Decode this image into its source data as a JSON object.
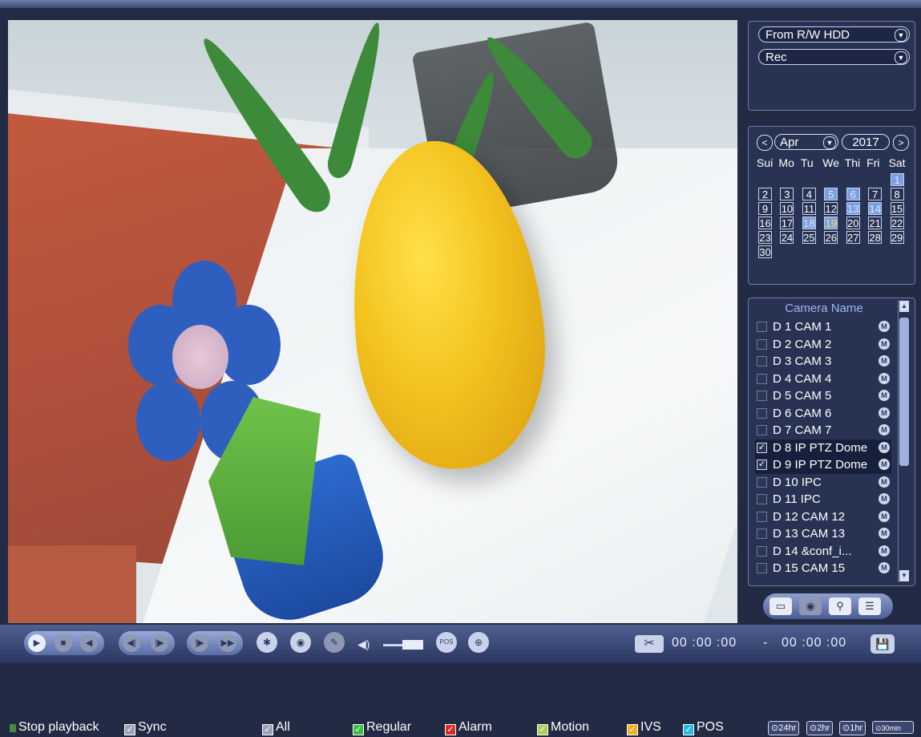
{
  "source": {
    "select_value": "From R/W HDD",
    "type_value": "Rec"
  },
  "calendar": {
    "prev_label": "<",
    "next_label": ">",
    "month": "Apr",
    "year": "2017",
    "weekdays": [
      "Sui",
      "Mo",
      "Tu",
      "We",
      "Thi",
      "Fri",
      "Sat"
    ],
    "days": [
      {
        "label": "",
        "state": "blank"
      },
      {
        "label": "",
        "state": "blank"
      },
      {
        "label": "",
        "state": "blank"
      },
      {
        "label": "",
        "state": "blank"
      },
      {
        "label": "",
        "state": "blank"
      },
      {
        "label": "",
        "state": "blank"
      },
      {
        "label": "1",
        "state": "rec"
      },
      {
        "label": "2",
        "state": ""
      },
      {
        "label": "3",
        "state": ""
      },
      {
        "label": "4",
        "state": ""
      },
      {
        "label": "5",
        "state": "rec"
      },
      {
        "label": "6",
        "state": "rec"
      },
      {
        "label": "7",
        "state": ""
      },
      {
        "label": "8",
        "state": ""
      },
      {
        "label": "9",
        "state": ""
      },
      {
        "label": "10",
        "state": ""
      },
      {
        "label": "11",
        "state": ""
      },
      {
        "label": "12",
        "state": ""
      },
      {
        "label": "13",
        "state": "rec"
      },
      {
        "label": "14",
        "state": "rec"
      },
      {
        "label": "15",
        "state": ""
      },
      {
        "label": "16",
        "state": ""
      },
      {
        "label": "17",
        "state": ""
      },
      {
        "label": "18",
        "state": "rec"
      },
      {
        "label": "19",
        "state": "today"
      },
      {
        "label": "20",
        "state": ""
      },
      {
        "label": "21",
        "state": ""
      },
      {
        "label": "22",
        "state": ""
      },
      {
        "label": "23",
        "state": ""
      },
      {
        "label": "24",
        "state": ""
      },
      {
        "label": "25",
        "state": ""
      },
      {
        "label": "26",
        "state": ""
      },
      {
        "label": "27",
        "state": ""
      },
      {
        "label": "28",
        "state": ""
      },
      {
        "label": "29",
        "state": ""
      },
      {
        "label": "30",
        "state": ""
      }
    ]
  },
  "cameras": {
    "title": "Camera Name",
    "mode_badge": "M",
    "items": [
      {
        "name": "D 1 CAM 1",
        "checked": false
      },
      {
        "name": "D 2 CAM 2",
        "checked": false
      },
      {
        "name": "D 3 CAM 3",
        "checked": false
      },
      {
        "name": "D 4 CAM 4",
        "checked": false
      },
      {
        "name": "D 5 CAM 5",
        "checked": false
      },
      {
        "name": "D 6 CAM 6",
        "checked": false
      },
      {
        "name": "D 7 CAM 7",
        "checked": false
      },
      {
        "name": "D 8 IP PTZ Dome",
        "checked": true
      },
      {
        "name": "D 9 IP PTZ Dome",
        "checked": true
      },
      {
        "name": "D 10 IPC",
        "checked": false
      },
      {
        "name": "D 11 IPC",
        "checked": false
      },
      {
        "name": "D 12 CAM 12",
        "checked": false
      },
      {
        "name": "D 13 CAM 13",
        "checked": false
      },
      {
        "name": "D 14 &conf_i...",
        "checked": false
      },
      {
        "name": "D 15 CAM 15",
        "checked": false
      }
    ]
  },
  "search_tools": [
    "search-icon",
    "smart-search-icon",
    "tag-search-icon",
    "file-list-icon"
  ],
  "controls": {
    "clip_label": "✂",
    "start_time": "00 :00 :00",
    "separator": "-",
    "end_time": "00 :00 :00",
    "pos_label": "POS"
  },
  "bottom": {
    "stop_playback": "Stop playback",
    "sync": "Sync",
    "all": "All",
    "regular": "Regular",
    "alarm": "Alarm",
    "motion": "Motion",
    "ivs": "IVS",
    "pos": "POS",
    "zoom": [
      "24hr",
      "2hr",
      "1hr",
      "30min"
    ]
  },
  "colors": {
    "regular": "#3fbf3f",
    "alarm": "#e02828",
    "motion": "#a8d05a",
    "ivs": "#f0b020",
    "pos": "#28b8e0",
    "sync": "#9aa4b8",
    "all": "#9aa4b8",
    "stop": "#3f8f3f"
  }
}
